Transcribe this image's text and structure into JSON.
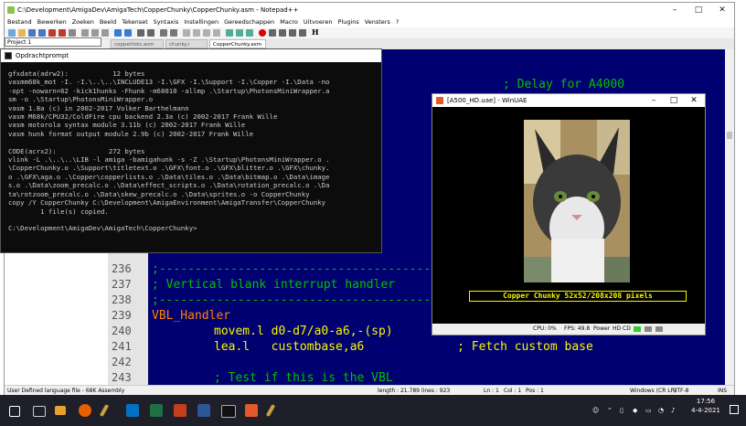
{
  "notepad": {
    "title": "C:\\Development\\AmigaDev\\AmigaTech\\CopperChunky\\CopperChunky.asm - Notepad++",
    "menu": [
      "Bestand",
      "Bewerken",
      "Zoeken",
      "Beeld",
      "Tekenset",
      "Syntaxis",
      "Instellingen",
      "Gereedschappen",
      "Macro",
      "Uitvoeren",
      "Plugins",
      "Vensters",
      "?"
    ],
    "project_label": "Project 1",
    "tabs": [
      "copperlists.asm",
      "chunky.i",
      "CopperChunky.asm"
    ],
    "active_tab": "CopperChunky.asm",
    "code_lines": [
      {
        "num": "236",
        "text": ";---------------------------------------------"
      },
      {
        "num": "237",
        "text": "; Vertical blank interrupt handler"
      },
      {
        "num": "238",
        "text": ";---------------------------------------------"
      },
      {
        "num": "239",
        "text": "VBL_Handler"
      },
      {
        "num": "240",
        "text": "movem.l d0-d7/a0-a6,-(sp)"
      },
      {
        "num": "241",
        "text": "lea.l   custombase,a6             ; Fetch custom base"
      },
      {
        "num": "242",
        "text": ""
      },
      {
        "num": "243",
        "text": "; Test if this is the VBL"
      }
    ],
    "top_comment": "; Delay for A4000",
    "status": {
      "left": "User Defined language file - 68K Assembly",
      "length": "length : 21.789",
      "lines": "lines : 923",
      "ln": "Ln : 1",
      "col": "Col : 1",
      "pos": "Pos : 1",
      "eol": "Windows (CR LF)",
      "encoding": "UTF-8",
      "mode": "INS"
    }
  },
  "cmd": {
    "title": "Opdrachtprompt",
    "output": "gfxdata(adrw2):           12 bytes\nvasmm68k_mot -I. -I.\\..\\..\\INCLUDE13 -I.\\GFX -I.\\Support -I.\\Copper -I.\\Data -no\n-opt -nowarn=62 -kick1hunks -Fhunk -m68010 -allmp .\\Startup\\PhotonsMiniWrapper.a\nsm -o .\\Startup\\PhotonsMiniWrapper.o\nvasm 1.8a (c) in 2002-2017 Volker Barthelmann\nvasm M68k/CPU32/ColdFire cpu backend 2.3a (c) 2002-2017 Frank Wille\nvasm motorola syntax module 3.11b (c) 2002-2017 Frank Wille\nvasm hunk format output module 2.9b (c) 2002-2017 Frank Wille\n\nCODE(acrx2):             272 bytes\nvlink -L .\\..\\..\\LIB -l amiga -bamigahunk -s -Z .\\Startup\\PhotonsMiniWrapper.o .\n\\CopperChunky.o .\\Support\\titletext.o .\\GFX\\font.o .\\GFX\\blitter.o .\\GFX\\chunky.\no .\\GFX\\aga.o .\\Copper\\copperlists.o .\\Data\\tiles.o .\\Data\\bitmap.o .\\Data\\image\ns.o .\\Data\\zoom_precalc.o .\\Data\\effect_scripts.o .\\Data\\rotation_precalc.o .\\Da\nta\\rotzoom_precalc.o .\\Data\\skew_precalc.o .\\Data\\sprites.o -o CopperChunky\ncopy /Y CopperChunky C:\\Development\\AmigaEnvironment\\AmigaTransfer\\CopperChunky\n        1 file(s) copied.\n\nC:\\Development\\AmigaDev\\AmigaTech\\CopperChunky>"
  },
  "uae": {
    "title": "[A500_HD.uae] - WinUAE",
    "caption": "Copper Chunky 52x52/208x208 pixels",
    "status_cpu": "CPU: 0%",
    "status_fps": "FPS: 49.8",
    "status_power": "Power",
    "status_hd": "HD",
    "status_cd": "CD"
  },
  "taskbar": {
    "time": "17:56",
    "date": "4-4-2021"
  },
  "colors": {
    "editor_bg": "#000070",
    "comment_green": "#00c000",
    "label_orange": "#ff8000",
    "uae_yellow": "#f8f800"
  }
}
